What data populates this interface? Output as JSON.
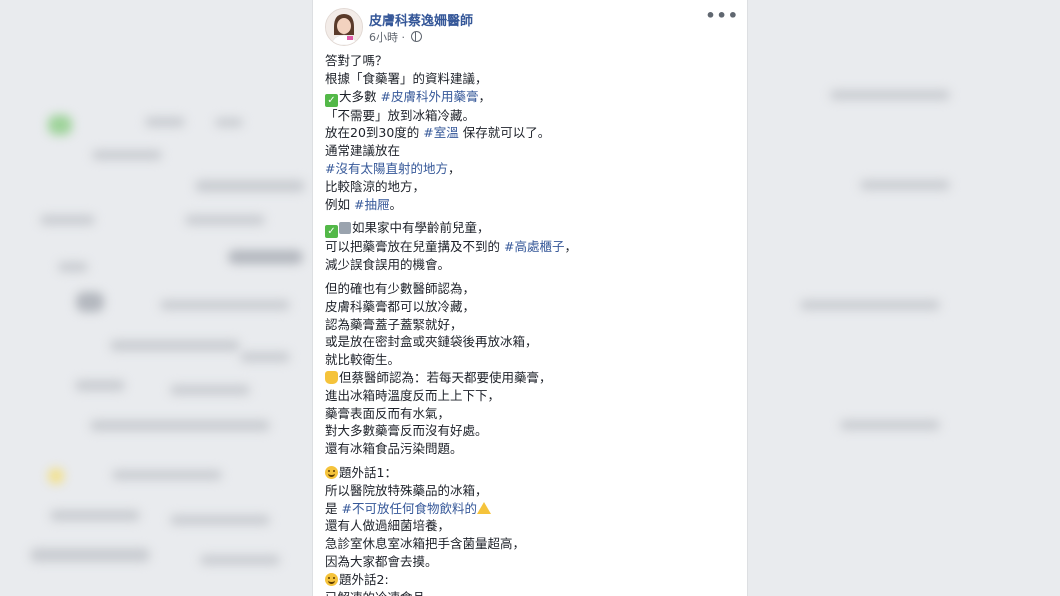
{
  "post": {
    "author": "皮膚科蔡逸姍醫師",
    "time": "6小時",
    "separator": " · ",
    "more": "•••"
  },
  "paragraphs": [
    [
      [
        {
          "t": "答對了嗎？"
        }
      ],
      [
        {
          "t": "根據「食藥署」的資料建議，"
        }
      ],
      [
        {
          "e": "check"
        },
        {
          "t": "大多數 "
        },
        {
          "tag": "#皮膚科外用藥膏"
        },
        {
          "t": "，"
        }
      ],
      [
        {
          "t": "「不需要」放到冰箱冷藏。"
        }
      ],
      [
        {
          "t": "放在20到30度的 "
        },
        {
          "tag": "#室溫"
        },
        {
          "t": " 保存就可以了。"
        }
      ],
      [
        {
          "t": "通常建議放在"
        }
      ],
      [
        {
          "tag": "#沒有太陽直射的地方"
        },
        {
          "t": "，"
        }
      ],
      [
        {
          "t": "比較陰涼的地方，"
        }
      ],
      [
        {
          "t": "例如 "
        },
        {
          "tag": "#抽屜"
        },
        {
          "t": "。"
        }
      ]
    ],
    [
      [
        {
          "e": "check"
        },
        {
          "e": "numsq"
        },
        {
          "t": "如果家中有學齡前兒童，"
        }
      ],
      [
        {
          "t": "可以把藥膏放在兒童搆及不到的 "
        },
        {
          "tag": "#高處櫃子"
        },
        {
          "t": "，"
        }
      ],
      [
        {
          "t": "減少誤食誤用的機會。"
        }
      ]
    ],
    [
      [
        {
          "t": "但的確也有少數醫師認為，"
        }
      ],
      [
        {
          "t": "皮膚科藥膏都可以放冷藏，"
        }
      ],
      [
        {
          "t": "認為藥膏蓋子蓋緊就好，"
        }
      ],
      [
        {
          "t": "或是放在密封盒或夾鏈袋後再放冰箱，"
        }
      ],
      [
        {
          "t": "就比較衛生。"
        }
      ],
      [
        {
          "e": "hand"
        },
        {
          "t": "但蔡醫師認為：若每天都要使用藥膏，"
        }
      ],
      [
        {
          "t": "進出冰箱時溫度反而上上下下，"
        }
      ],
      [
        {
          "t": "藥膏表面反而有水氣，"
        }
      ],
      [
        {
          "t": "對大多數藥膏反而沒有好處。"
        }
      ],
      [
        {
          "t": "還有冰箱食品污染問題。"
        }
      ]
    ],
    [
      [
        {
          "e": "smile"
        },
        {
          "t": "題外話1："
        }
      ],
      [
        {
          "t": "所以醫院放特殊藥品的冰箱，"
        }
      ],
      [
        {
          "t": "是 "
        },
        {
          "tag": "#不可放任何食物飲料的"
        },
        {
          "e": "warn"
        }
      ],
      [
        {
          "t": "還有人做過細菌培養，"
        }
      ],
      [
        {
          "t": "急診室休息室冰箱把手含菌量超高，"
        }
      ],
      [
        {
          "t": "因為大家都會去摸。"
        }
      ],
      [
        {
          "e": "smile"
        },
        {
          "t": "題外話2:"
        }
      ],
      [
        {
          "t": "已解凍的冷凍食品，"
        }
      ]
    ]
  ],
  "icons": {
    "check": "white-check-mark-icon",
    "numsq": "number-key-icon",
    "hand": "raised-hand-icon",
    "smile": "smiley-face-icon",
    "warn": "warning-sign-icon"
  },
  "colors": {
    "link": "#365899",
    "text": "#1d2129",
    "meta": "#616770",
    "background": "#e9ebee"
  }
}
